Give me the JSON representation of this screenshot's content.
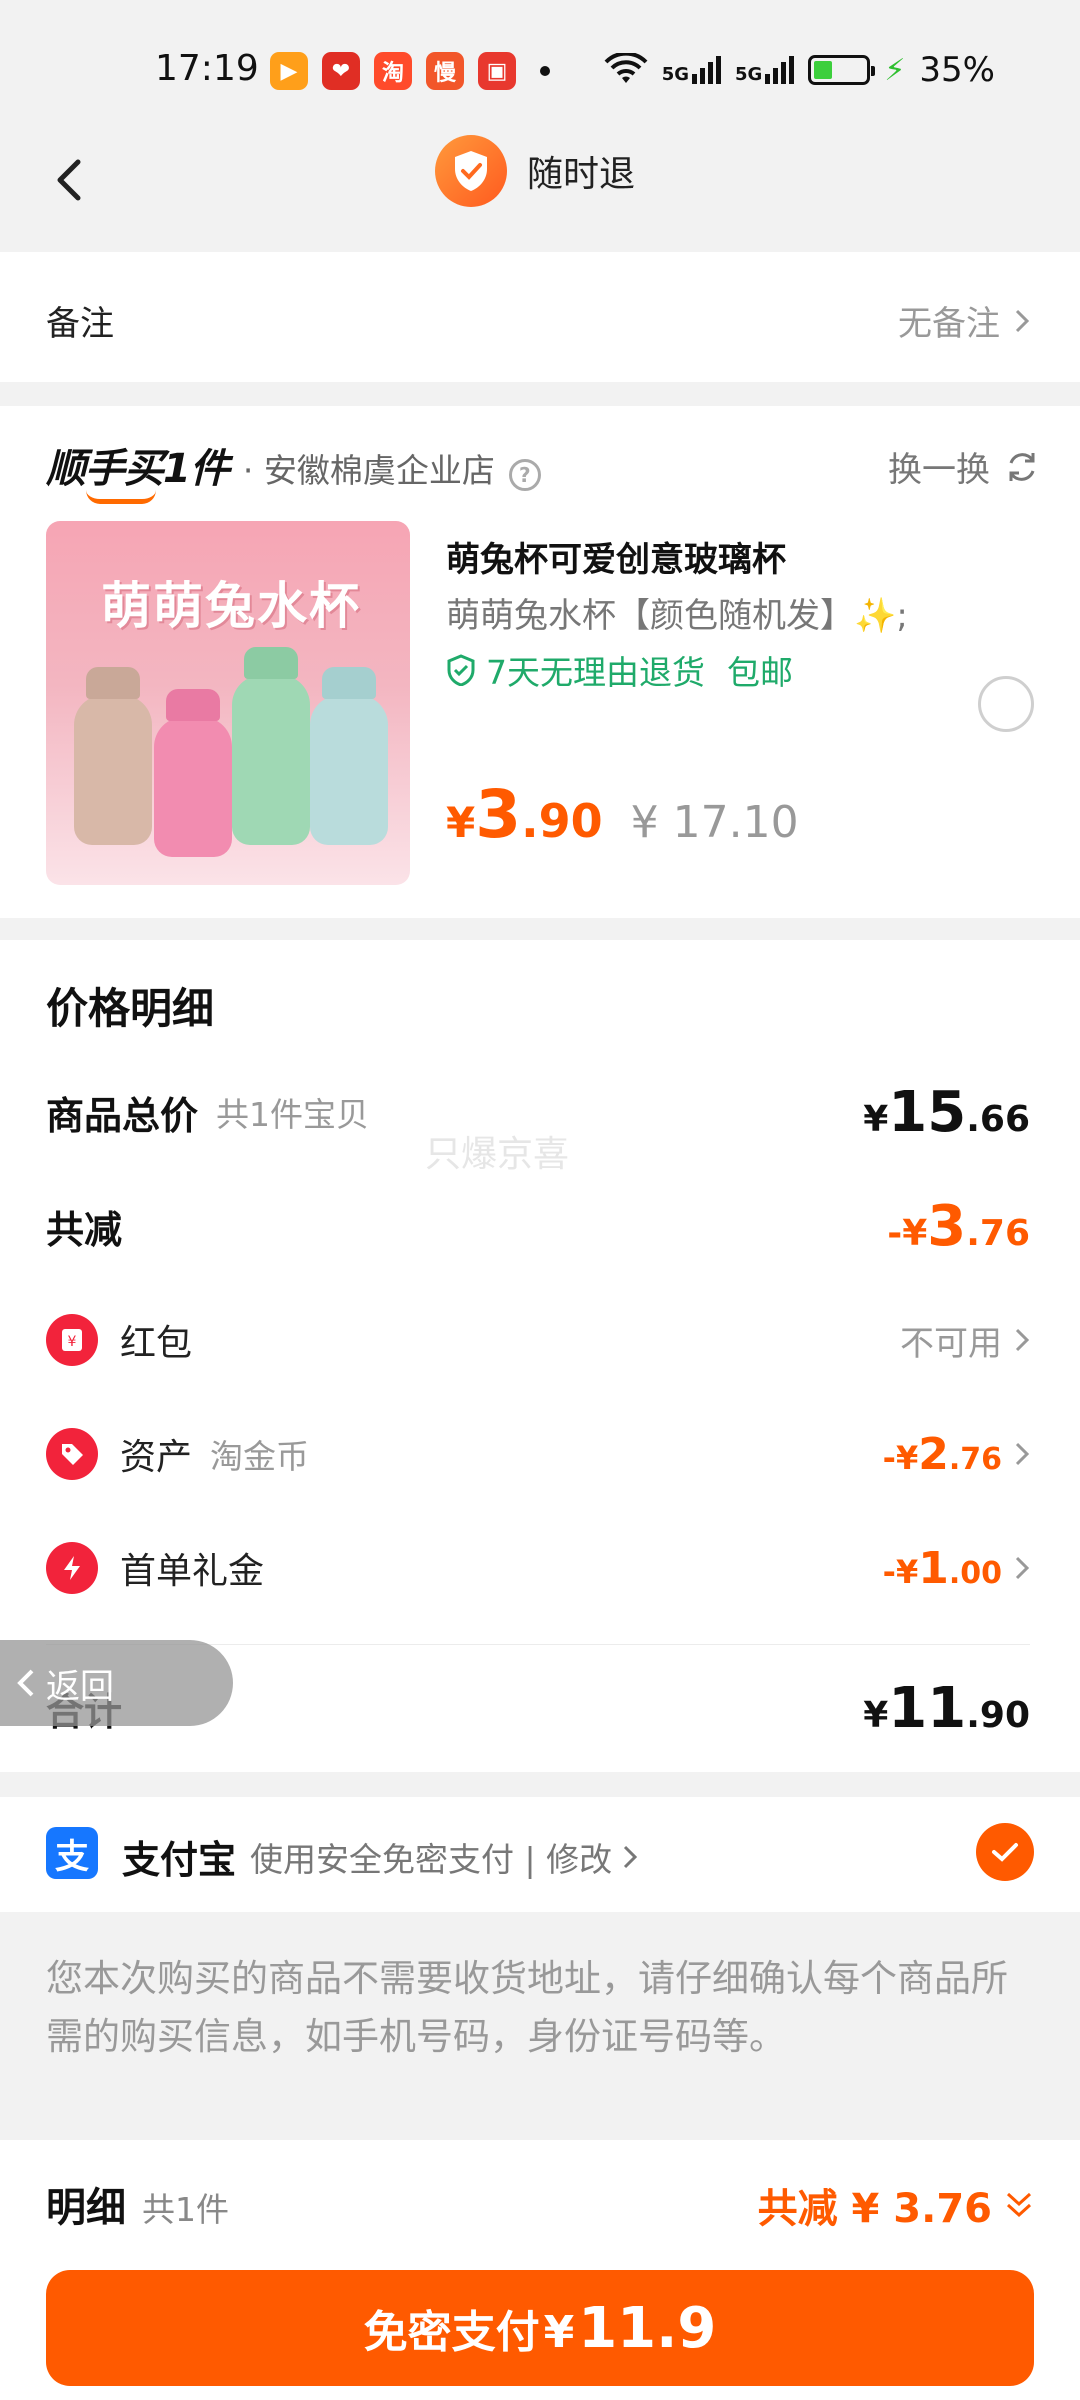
{
  "status_bar": {
    "time": "17:19",
    "battery": "35%",
    "network1": "5G",
    "network2": "5G",
    "battery_level": 0.35
  },
  "header": {
    "title": "随时退"
  },
  "remark": {
    "label": "备注",
    "value": "无备注"
  },
  "product_card": {
    "brand": "顺手买1件",
    "shop": "· 安徽棉虞企业店",
    "swap_label": "换一换",
    "image_text": "萌萌兔水杯",
    "title": "萌兔杯可爱创意玻璃杯",
    "subtitle": "萌萌兔水杯【颜色随机发】✨;",
    "tag_return": "7天无理由退货",
    "tag_shipping": "包邮",
    "price_symbol": "¥",
    "price_int": "3",
    "price_dec": ".90",
    "original_price": "¥ 17.10"
  },
  "price_detail": {
    "title": "价格明细",
    "total_label": "商品总价",
    "total_note": "共1件宝贝",
    "total": {
      "symbol": "¥",
      "int": "15",
      "dec": ".66"
    },
    "discount_label": "共减",
    "discount": {
      "symbol": "-¥",
      "int": "3",
      "dec": ".76"
    },
    "red_packet_label": "红包",
    "red_packet_value": "不可用",
    "asset_label": "资产",
    "asset_note": "淘金币",
    "asset": {
      "symbol": "-¥",
      "int": "2",
      "dec": ".76"
    },
    "first_order_label": "首单礼金",
    "first_order": {
      "symbol": "-¥",
      "int": "1",
      "dec": ".00"
    },
    "sum_label": "合计",
    "sum": {
      "symbol": "¥",
      "int": "11",
      "dec": ".90"
    }
  },
  "float_back": {
    "label": "返回"
  },
  "payment": {
    "method": "支付宝",
    "icon_char": "支",
    "desc": "使用安全免密支付 | 修改"
  },
  "notice": "您本次购买的商品不需要收货地址，请仔细确认每个商品所需的购买信息，如手机号码，身份证号码等。",
  "bottom_bar": {
    "detail_label": "明细",
    "count": "共1件",
    "discount_text": "共减 ¥ 3.76",
    "pay_label": "免密支付",
    "pay_symbol": "¥",
    "pay_amount": "11.9"
  },
  "watermark": "只爆京喜",
  "colors": {
    "accent": "#ff5a00",
    "green": "#1faa6a",
    "alipay": "#1677ff",
    "red": "#f2233b"
  }
}
